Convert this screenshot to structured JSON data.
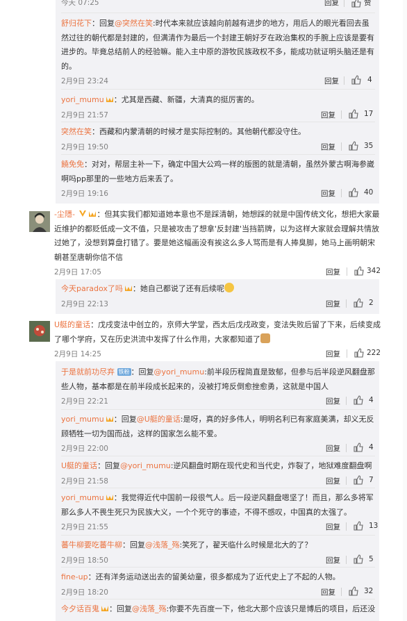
{
  "comments": [
    {
      "id": "c0",
      "kind": "sub",
      "user": "",
      "text_parts": [],
      "time": "今天 07:25",
      "reply": "回复",
      "likes": "赞"
    },
    {
      "id": "c1",
      "kind": "sub",
      "user": "舒归花下",
      "colon": "：回复",
      "mention": "@突然在笑",
      "text": ":时代本来就应该越向前越有进步的地方，用后人的眼光看回去虽然过往的朝代都是封建的，但满清作为最后一个封建王朝好歹在政治集权的手腕上应该是要有进步的。毕竟总结前人的经验嘛。能入主中原的游牧民族政权不多，能成功就证明头脑还是有的。",
      "time": "2月9日 23:24",
      "reply": "回复",
      "likes": "4"
    },
    {
      "id": "c2",
      "kind": "sub",
      "user": "yori_mumu",
      "text": "：尤其是西藏、新疆，大清真的挺厉害的。",
      "time": "2月9日 21:57",
      "reply": "回复",
      "likes": "17"
    },
    {
      "id": "c3",
      "kind": "sub",
      "user": "突然在笑",
      "text": "：西藏和内蒙清朝的时候才是实际控制的。其他朝代都没守住。",
      "time": "2月9日 19:50",
      "reply": "回复",
      "likes": "35"
    },
    {
      "id": "c4",
      "kind": "sub",
      "user": "饒免免",
      "text": "：对对，帮层主补一下，确定中国大公鸡一样的版图的就是清朝，虽然外蒙古啊海参崴啊吗pp那里的一些地方后来丢了。",
      "time": "2月9日 19:16",
      "reply": "回复",
      "likes": "40"
    },
    {
      "id": "c5",
      "kind": "top",
      "user": "-尘隱-",
      "text": "：但其实我们都知道她本意也不是踩清朝，她想踩的就是中国传统文化，想把大家最近维护的都贬低成一文不值，只是被攻击了想拿'反封建'当挡箭牌，以为这样大家就会理解共情放过她了，没想到算盘打错了。要是她这幅画没有挨这么多人骂而是有人捧臭脚，她马上画明朝宋朝甚至唐朝你信不信",
      "time": "2月9日 17:05",
      "reply": "回复",
      "likes": "342"
    },
    {
      "id": "c6",
      "kind": "sub",
      "user": "今天paradox了吗",
      "text": "：她自己都说了还有后续呢",
      "time": "2月9日 22:13",
      "reply": "回复",
      "likes": "2"
    },
    {
      "id": "c7",
      "kind": "top",
      "user": "U艇的童话",
      "text": "：戊戌变法中创立的，京师大学堂，西太后戊戌政变，变法失败后留了下来，后续变成了哪个学府，又在历史洪流中发挥了什么作用，大家都知道了",
      "time": "2月9日 14:25",
      "reply": "回复",
      "likes": "222"
    },
    {
      "id": "c8",
      "kind": "sub",
      "user": "于是就前功尽弃",
      "tag": "铁粉",
      "colon": "：回复",
      "mention": "@yori_mumu",
      "text": ":前半段历程简直是致郁，但参与后半段逆风翻盘那些人物，基本都是在前半段成长起来的，没被打垮反倒愈挫愈勇，这就是中国人",
      "time": "2月9日 22:21",
      "reply": "回复",
      "likes": "4"
    },
    {
      "id": "c9",
      "kind": "sub",
      "user": "yori_mumu",
      "colon": "：回复",
      "mention": "@U艇的童话",
      "text": ":是呀，真的好多伟人，明明名利已有家庭美满，却义无反顾牺牲一切为国而战，这样的国家怎么能不爱。",
      "time": "2月9日 22:00",
      "reply": "回复",
      "likes": "4"
    },
    {
      "id": "c10",
      "kind": "sub",
      "user": "U艇的童话",
      "colon": "：回复",
      "mention": "@yori_mumu",
      "text": ":逆风翻盘时期在现代史和当代史，炸裂了，地狱难度翻盘啊",
      "time": "2月9日 21:58",
      "reply": "回复",
      "likes": "7"
    },
    {
      "id": "c11",
      "kind": "sub",
      "user": "yori_mumu",
      "text": "：我觉得近代中国前一段很气人。后一段逆风翻盘嗯坚了！而且，那么多将军那么多人不畏生死只为民族大义，一个个死守的事迹，不得不感叹，中国真的太强了。",
      "time": "2月9日 21:55",
      "reply": "回复",
      "likes": "13"
    },
    {
      "id": "c12",
      "kind": "sub",
      "user": "蕃牛柳要吃蕃牛柳",
      "colon": "：回复",
      "mention": "@浅落_殇",
      "text": ":笑死了，翟天临什么时候是北大的了？",
      "time": "2月9日 18:50",
      "reply": "回复",
      "likes": "5"
    },
    {
      "id": "c13",
      "kind": "sub",
      "user": "fine-up",
      "text": "：还有洋务运动送出去的留美幼童，很多都成为了近代史上了不起的人物。",
      "time": "2月9日 18:20",
      "reply": "回复",
      "likes": "32"
    },
    {
      "id": "c14",
      "kind": "sub",
      "user": "今夕话百鬼",
      "colon": "：回复",
      "mention": "@浅落_殇",
      "text": ":你要不先百度一下，他北大那个应该只是博后的项目，后还没",
      "time": "",
      "reply": "",
      "likes": ""
    }
  ],
  "icons": {
    "like": "thumbs-up-icon",
    "vip": "vip-badge-icon",
    "member": "member-badge-icon"
  },
  "colors": {
    "username": "#eb7340",
    "subbg": "#f2f2f5",
    "meta": "#808080"
  }
}
